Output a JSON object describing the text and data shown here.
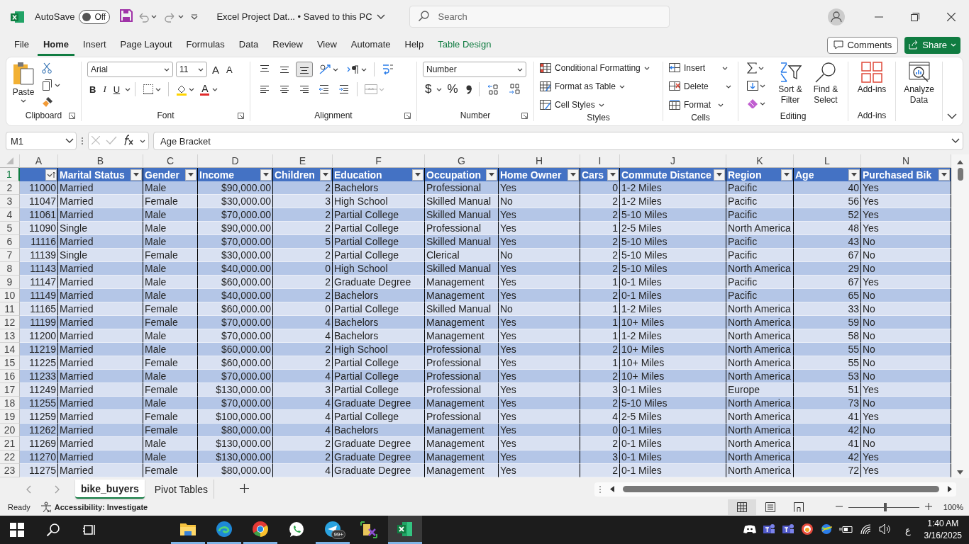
{
  "title_bar": {
    "autosave_label": "AutoSave",
    "autosave_toggle": {
      "on": false,
      "label": "Off"
    },
    "document_title": "Excel Project Dat... • Saved to this PC",
    "search_placeholder": "Search"
  },
  "menu_tabs": [
    {
      "label": "File",
      "selected": false,
      "kind": "plain"
    },
    {
      "label": "Home",
      "selected": true,
      "kind": "plain"
    },
    {
      "label": "Insert",
      "selected": false,
      "kind": "plain"
    },
    {
      "label": "Page Layout",
      "selected": false,
      "kind": "plain"
    },
    {
      "label": "Formulas",
      "selected": false,
      "kind": "plain"
    },
    {
      "label": "Data",
      "selected": false,
      "kind": "plain"
    },
    {
      "label": "Review",
      "selected": false,
      "kind": "plain"
    },
    {
      "label": "View",
      "selected": false,
      "kind": "plain"
    },
    {
      "label": "Automate",
      "selected": false,
      "kind": "plain"
    },
    {
      "label": "Help",
      "selected": false,
      "kind": "plain"
    },
    {
      "label": "Table Design",
      "selected": false,
      "kind": "contextual"
    }
  ],
  "comments_button": "Comments",
  "share_button": "Share",
  "ribbon": {
    "clipboard": {
      "label": "Clipboard",
      "paste": "Paste"
    },
    "font": {
      "label": "Font",
      "font_name": "Arial",
      "font_size": "11",
      "grow": "A",
      "shrink": "A",
      "bold": "B",
      "italic": "I",
      "underline": "U",
      "font_color": "A"
    },
    "alignment": {
      "label": "Alignment",
      "vertical": [
        {
          "kind": "top",
          "selected": false
        },
        {
          "kind": "middle",
          "selected": false
        },
        {
          "kind": "bottom",
          "selected": true
        }
      ]
    },
    "number": {
      "label": "Number",
      "format": "Number",
      "currency": "$",
      "percent": "%"
    },
    "styles": {
      "label": "Styles",
      "items": [
        "Conditional Formatting",
        "Format as Table",
        "Cell Styles"
      ]
    },
    "cells": {
      "label": "Cells",
      "items": [
        "Insert",
        "Delete",
        "Format"
      ]
    },
    "editing": {
      "label": "Editing",
      "sort_filter": "Sort & Filter",
      "find_select": "Find & Select"
    },
    "addins": {
      "label": "Add-ins",
      "button": "Add-ins"
    },
    "analyze": {
      "button": "Analyze Data"
    }
  },
  "formula_bar": {
    "name_box": "M1",
    "formula": "Age Bracket"
  },
  "columns": [
    {
      "letter": "A",
      "kind": "number",
      "sorted": true
    },
    {
      "letter": "B",
      "header": "Marital Status",
      "kind": "text",
      "sorted": false
    },
    {
      "letter": "C",
      "header": "Gender",
      "kind": "text",
      "sorted": false
    },
    {
      "letter": "D",
      "header": "Income",
      "kind": "number",
      "sorted": false
    },
    {
      "letter": "E",
      "header": "Children",
      "kind": "number",
      "sorted": false
    },
    {
      "letter": "F",
      "header": "Education",
      "kind": "text",
      "sorted": false
    },
    {
      "letter": "G",
      "header": "Occupation",
      "kind": "text",
      "sorted": false
    },
    {
      "letter": "H",
      "header": "Home Owner",
      "kind": "text",
      "sorted": false
    },
    {
      "letter": "I",
      "header": "Cars",
      "kind": "number",
      "sorted": false
    },
    {
      "letter": "J",
      "header": "Commute Distance",
      "kind": "text",
      "sorted": false
    },
    {
      "letter": "K",
      "header": "Region",
      "kind": "text",
      "sorted": false
    },
    {
      "letter": "L",
      "header": "Age",
      "kind": "number",
      "sorted": false
    },
    {
      "letter": "N",
      "header": "Purchased Bik",
      "kind": "text",
      "sorted": false
    }
  ],
  "rows": [
    {
      "n": "2",
      "cells": [
        "11000",
        "Married",
        "Male",
        "$90,000.00",
        "2",
        "Bachelors",
        "Professional",
        "Yes",
        "0",
        "1-2 Miles",
        "Pacific",
        "40",
        "Yes"
      ]
    },
    {
      "n": "3",
      "cells": [
        "11047",
        "Married",
        "Female",
        "$30,000.00",
        "3",
        "High School",
        "Skilled Manual",
        "No",
        "2",
        "1-2 Miles",
        "Pacific",
        "56",
        "Yes"
      ]
    },
    {
      "n": "4",
      "cells": [
        "11061",
        "Married",
        "Male",
        "$70,000.00",
        "2",
        "Partial College",
        "Skilled Manual",
        "Yes",
        "2",
        "5-10 Miles",
        "Pacific",
        "52",
        "Yes"
      ]
    },
    {
      "n": "5",
      "cells": [
        "11090",
        "Single",
        "Male",
        "$90,000.00",
        "2",
        "Partial College",
        "Professional",
        "Yes",
        "1",
        "2-5 Miles",
        "North America",
        "48",
        "Yes"
      ]
    },
    {
      "n": "6",
      "cells": [
        "11116",
        "Married",
        "Male",
        "$70,000.00",
        "5",
        "Partial College",
        "Skilled Manual",
        "Yes",
        "2",
        "5-10 Miles",
        "Pacific",
        "43",
        "No"
      ]
    },
    {
      "n": "7",
      "cells": [
        "11139",
        "Single",
        "Female",
        "$30,000.00",
        "2",
        "Partial College",
        "Clerical",
        "No",
        "2",
        "5-10 Miles",
        "Pacific",
        "67",
        "No"
      ]
    },
    {
      "n": "8",
      "cells": [
        "11143",
        "Married",
        "Male",
        "$40,000.00",
        "0",
        "High School",
        "Skilled Manual",
        "Yes",
        "2",
        "5-10 Miles",
        "North America",
        "29",
        "No"
      ]
    },
    {
      "n": "9",
      "cells": [
        "11147",
        "Married",
        "Male",
        "$60,000.00",
        "2",
        "Graduate Degree",
        "Management",
        "Yes",
        "1",
        "0-1 Miles",
        "Pacific",
        "67",
        "Yes"
      ]
    },
    {
      "n": "10",
      "cells": [
        "11149",
        "Married",
        "Male",
        "$40,000.00",
        "2",
        "Bachelors",
        "Management",
        "Yes",
        "2",
        "0-1 Miles",
        "Pacific",
        "65",
        "No"
      ]
    },
    {
      "n": "11",
      "cells": [
        "11165",
        "Married",
        "Female",
        "$60,000.00",
        "0",
        "Partial College",
        "Skilled Manual",
        "No",
        "1",
        "1-2 Miles",
        "North America",
        "33",
        "No"
      ]
    },
    {
      "n": "12",
      "cells": [
        "11199",
        "Married",
        "Female",
        "$70,000.00",
        "4",
        "Bachelors",
        "Management",
        "Yes",
        "1",
        "10+ Miles",
        "North America",
        "59",
        "No"
      ]
    },
    {
      "n": "13",
      "cells": [
        "11200",
        "Married",
        "Male",
        "$70,000.00",
        "4",
        "Bachelors",
        "Management",
        "Yes",
        "1",
        "1-2 Miles",
        "North America",
        "58",
        "No"
      ]
    },
    {
      "n": "14",
      "cells": [
        "11219",
        "Married",
        "Male",
        "$60,000.00",
        "2",
        "High School",
        "Professional",
        "Yes",
        "2",
        "10+ Miles",
        "North America",
        "55",
        "No"
      ]
    },
    {
      "n": "15",
      "cells": [
        "11225",
        "Married",
        "Female",
        "$60,000.00",
        "2",
        "Partial College",
        "Professional",
        "Yes",
        "1",
        "10+ Miles",
        "North America",
        "55",
        "No"
      ]
    },
    {
      "n": "16",
      "cells": [
        "11233",
        "Married",
        "Male",
        "$70,000.00",
        "4",
        "Partial College",
        "Professional",
        "Yes",
        "2",
        "10+ Miles",
        "North America",
        "53",
        "No"
      ]
    },
    {
      "n": "17",
      "cells": [
        "11249",
        "Married",
        "Female",
        "$130,000.00",
        "3",
        "Partial College",
        "Professional",
        "Yes",
        "3",
        "0-1 Miles",
        "Europe",
        "51",
        "Yes"
      ]
    },
    {
      "n": "18",
      "cells": [
        "11255",
        "Married",
        "Male",
        "$70,000.00",
        "4",
        "Graduate Degree",
        "Management",
        "Yes",
        "2",
        "5-10 Miles",
        "North America",
        "73",
        "No"
      ]
    },
    {
      "n": "19",
      "cells": [
        "11259",
        "Married",
        "Female",
        "$100,000.00",
        "4",
        "Partial College",
        "Professional",
        "Yes",
        "4",
        "2-5 Miles",
        "North America",
        "41",
        "Yes"
      ]
    },
    {
      "n": "20",
      "cells": [
        "11262",
        "Married",
        "Female",
        "$80,000.00",
        "4",
        "Bachelors",
        "Management",
        "Yes",
        "0",
        "0-1 Miles",
        "North America",
        "42",
        "No"
      ]
    },
    {
      "n": "21",
      "cells": [
        "11269",
        "Married",
        "Male",
        "$130,000.00",
        "2",
        "Graduate Degree",
        "Management",
        "Yes",
        "2",
        "0-1 Miles",
        "North America",
        "41",
        "No"
      ]
    },
    {
      "n": "22",
      "cells": [
        "11270",
        "Married",
        "Male",
        "$130,000.00",
        "2",
        "Graduate Degree",
        "Management",
        "Yes",
        "3",
        "0-1 Miles",
        "North America",
        "42",
        "Yes"
      ]
    },
    {
      "n": "23",
      "cells": [
        "11275",
        "Married",
        "Female",
        "$80,000.00",
        "4",
        "Graduate Degree",
        "Management",
        "Yes",
        "2",
        "0-1 Miles",
        "North America",
        "72",
        "Yes"
      ]
    }
  ],
  "header_row_number": "1",
  "sheet_tabs": [
    {
      "label": "bike_buyers",
      "selected": true
    },
    {
      "label": "Pivot Tables",
      "selected": false
    }
  ],
  "status_bar": {
    "status": "Ready",
    "accessibility": "Accessibility: Investigate",
    "views": [
      {
        "kind": "normal",
        "selected": true
      },
      {
        "kind": "page-layout",
        "selected": false
      },
      {
        "kind": "page-break",
        "selected": false
      }
    ],
    "zoom": {
      "level": 0.5,
      "label": "100%"
    }
  },
  "taskbar": {
    "apps": [
      {
        "kind": "start",
        "running": false,
        "active": false
      },
      {
        "kind": "search",
        "running": false,
        "active": false
      },
      {
        "kind": "task-view",
        "running": false,
        "active": false
      },
      {
        "kind": "folder",
        "running": true,
        "active": false
      },
      {
        "kind": "edge",
        "running": true,
        "active": false
      },
      {
        "kind": "chrome",
        "running": true,
        "active": false
      },
      {
        "kind": "chat",
        "running": false,
        "active": false
      },
      {
        "kind": "plane",
        "running": true,
        "active": false,
        "badge": "99+"
      },
      {
        "kind": "tools",
        "running": false,
        "active": false
      },
      {
        "kind": "excel",
        "running": true,
        "active": true
      }
    ],
    "tray": [
      {
        "kind": "gamepad"
      },
      {
        "kind": "teams"
      },
      {
        "kind": "teams"
      },
      {
        "kind": "ring"
      },
      {
        "kind": "globe"
      },
      {
        "kind": "battery"
      },
      {
        "kind": "wifi"
      },
      {
        "kind": "volume"
      }
    ],
    "language": "ع",
    "time": "1:40 AM",
    "date": "3/16/2025"
  }
}
